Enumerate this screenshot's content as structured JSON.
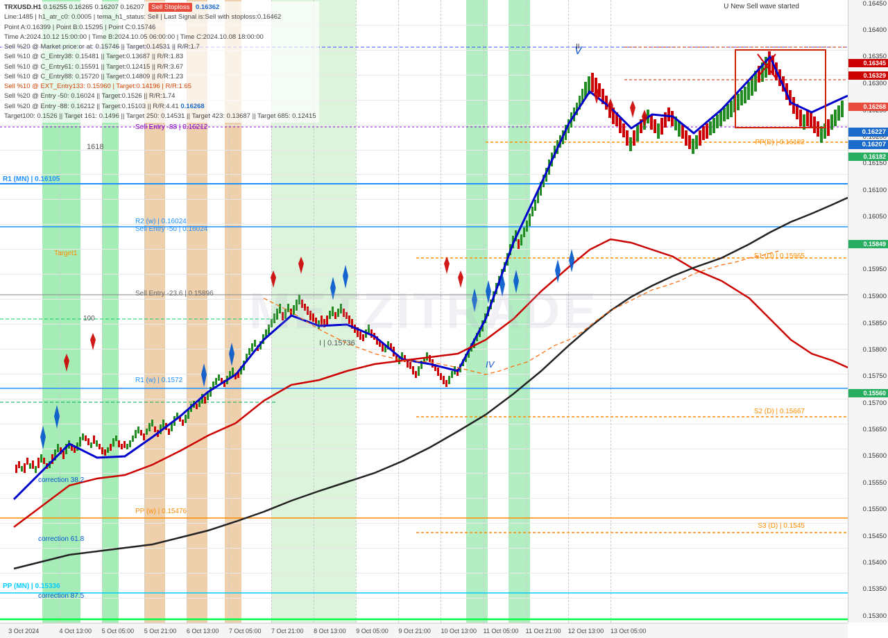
{
  "chart": {
    "title": "TRXUSD.H1",
    "subtitle": "0.16255 0.16265 0.16207 0.16207",
    "stoploss_label": "Sell Stoploss",
    "stoploss_value": "0.16362",
    "watermark": "METZITRADE",
    "top_annotation": "U New Sell wave started"
  },
  "info_lines": [
    "Line:1485  | h1_atr_c0: 0.0005  | tema_h1_status: Sell  | Last Signal is:Sell with stoploss:0.16462",
    "Point A:0.16399  | Point B:0.15295  | Point C:0.15746",
    "Time A:2024.10.12 15:00:00  | Time B:2024.10.05 06:00:00  | Time C:2024.10.08 18:00:00",
    "Sell %20 @ Market price or at: 0.15746  || Target:0.14531  || R/R:1.7",
    "Sell %10 @ C_Entry38: 0.15481  || Target:0.13687  || R/R:1.83",
    "Sell %10 @ C_Entry61: 0.15591  || Target:0.12415  || R/R:3.67",
    "Sell %10 @ C_Entry88: 0.15720  || Target:0.14809  || R/R:1.23",
    "Sell %10 @ EXT_Entry133: 0.15960 | Target:0.14196 | R/R:1.65",
    "Sell %20 @ Entry -50: 0.16024  || Target:0.1526  || R/R:1.74",
    "Sell %20 @ Entry -88: 0.16212  || Target:0.15103  || R/R:4.41",
    "Target100: 0.1526  || Target 161: 0.1496  || Target 250: 0.14531 || Target 423: 0.13687  || Target 685: 0.12415"
  ],
  "levels": [
    {
      "label": "PP (MN) | 0.15336",
      "price": 0.15336,
      "color": "#00ccff",
      "type": "horizontal"
    },
    {
      "label": "R1 (w) | 0.1572",
      "price": 0.1572,
      "color": "#00aaff",
      "type": "horizontal"
    },
    {
      "label": "PP (w) | 0.15476",
      "price": 0.15476,
      "color": "#ff8c00",
      "type": "horizontal"
    },
    {
      "label": "R1 (MN) | 0.16105",
      "price": 0.16105,
      "color": "#00aaff",
      "type": "horizontal"
    },
    {
      "label": "R2 (w) | 0.16024",
      "price": 0.16024,
      "color": "#00aaff",
      "type": "horizontal"
    },
    {
      "label": "Sell Entry -50 | 0.16024",
      "price": 0.16024,
      "color": "#00aaff",
      "type": "horizontal"
    },
    {
      "label": "Sell Entry -88 | 0.16212",
      "price": 0.16212,
      "color": "#8000ff",
      "type": "horizontal"
    },
    {
      "label": "Sell Entry -23.6 | 0.15896",
      "price": 0.15896,
      "color": "#888",
      "type": "horizontal"
    },
    {
      "label": "S1 (D) | 0.15965",
      "price": 0.15965,
      "color": "#ff8c00",
      "type": "horizontal"
    },
    {
      "label": "S2 (D) | 0.15667",
      "price": 0.15667,
      "color": "#ff8c00",
      "type": "horizontal"
    },
    {
      "label": "S3 (D) | 0.1545",
      "price": 0.1545,
      "color": "#ff8c00",
      "type": "horizontal"
    },
    {
      "label": "PP(D) | 0.16182",
      "price": 0.16182,
      "color": "#ff8c00",
      "type": "horizontal"
    }
  ],
  "price_tags": [
    {
      "price": "0.16345",
      "color": "#cc0000",
      "top_pct": 9.5
    },
    {
      "price": "0.16329",
      "color": "#cc0000",
      "top_pct": 11.5
    },
    {
      "price": "0.16268",
      "color": "#e74c3c",
      "top_pct": 16.5
    },
    {
      "price": "0.16227",
      "color": "#1a6bcc",
      "top_pct": 20.5
    },
    {
      "price": "0.16207",
      "color": "#1a6bcc",
      "top_pct": 22.5
    },
    {
      "price": "0.16182",
      "color": "#27ae60",
      "top_pct": 25.0
    },
    {
      "price": "0.15560",
      "color": "#27ae60",
      "top_pct": 62.5
    },
    {
      "price": "0.15849",
      "color": "#27ae60",
      "top_pct": 38.5
    }
  ],
  "time_labels": [
    {
      "label": "3 Oct 2024",
      "left_pct": 2
    },
    {
      "label": "4 Oct 13:00",
      "left_pct": 7
    },
    {
      "label": "5 Oct 05:00",
      "left_pct": 12
    },
    {
      "label": "5 Oct 21:00",
      "left_pct": 17
    },
    {
      "label": "6 Oct 13:00",
      "left_pct": 22
    },
    {
      "label": "7 Oct 05:00",
      "left_pct": 27
    },
    {
      "label": "7 Oct 21:00",
      "left_pct": 32
    },
    {
      "label": "8 Oct 13:00",
      "left_pct": 37
    },
    {
      "label": "9 Oct 05:00",
      "left_pct": 42
    },
    {
      "label": "9 Oct 21:00",
      "left_pct": 47
    },
    {
      "label": "10 Oct 13:00",
      "left_pct": 52
    },
    {
      "label": "11 Oct 05:00",
      "left_pct": 57
    },
    {
      "label": "11 Oct 21:00",
      "left_pct": 62
    },
    {
      "label": "12 Oct 13:00",
      "left_pct": 67
    },
    {
      "label": "13 Oct 05:00",
      "left_pct": 72
    }
  ],
  "price_scale": {
    "min": 0.1528,
    "max": 0.1645,
    "labels": [
      "0.16450",
      "0.16400",
      "0.16350",
      "0.16300",
      "0.16250",
      "0.16200",
      "0.16150",
      "0.16100",
      "0.16050",
      "0.16000",
      "0.15950",
      "0.15900",
      "0.15850",
      "0.15800",
      "0.15750",
      "0.15700",
      "0.15650",
      "0.15600",
      "0.15550",
      "0.15500",
      "0.15450",
      "0.15400",
      "0.15350",
      "0.15300"
    ]
  },
  "annotations": {
    "correction_38": "correction 38.2",
    "correction_61": "correction 61.8",
    "correction_87": "correction 87.5",
    "target1": "Target1",
    "label_100": "100",
    "label_1618": "1618",
    "roman_i": "I | 0.15736",
    "roman_iv": "IV",
    "roman_v_top": "V",
    "roman_ii": "II"
  },
  "colors": {
    "bg_green": "rgba(0,200,50,0.35)",
    "bg_orange": "rgba(210,120,20,0.35)",
    "bg_light_green": "rgba(100,220,100,0.2)",
    "level_cyan": "#00ccff",
    "level_blue": "#1e90ff",
    "level_orange": "#ff8c00",
    "ma_blue": "#0000cc",
    "ma_red": "#cc0000",
    "ma_black": "#000000"
  }
}
